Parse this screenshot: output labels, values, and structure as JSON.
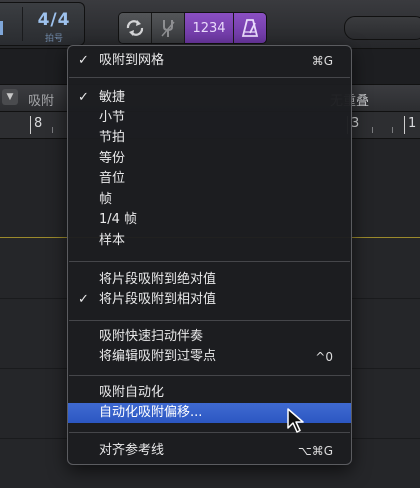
{
  "toolbar": {
    "time_signature": "4/4",
    "time_signature_label": "拍号",
    "count_in_label": "1234",
    "snap_label": "吸附",
    "overlap_label": "无重叠"
  },
  "ruler": {
    "bars": [
      "8",
      "3",
      "1"
    ]
  },
  "menu": {
    "snap_to_grid": {
      "label": "吸附到网格",
      "checked": true,
      "shortcut": "⌘G"
    },
    "snap_modes": [
      {
        "label": "敏捷",
        "checked": true
      },
      {
        "label": "小节",
        "checked": false
      },
      {
        "label": "节拍",
        "checked": false
      },
      {
        "label": "等份",
        "checked": false
      },
      {
        "label": "音位",
        "checked": false
      },
      {
        "label": "帧",
        "checked": false
      },
      {
        "label": "1/4 帧",
        "checked": false
      },
      {
        "label": "样本",
        "checked": false
      }
    ],
    "snap_regions": [
      {
        "label": "将片段吸附到绝对值",
        "checked": false
      },
      {
        "label": "将片段吸附到相对值",
        "checked": true
      }
    ],
    "snap_misc": [
      {
        "label": "吸附快速扫动伴奏",
        "shortcut": ""
      },
      {
        "label": "将编辑吸附到过零点",
        "shortcut": "^0"
      }
    ],
    "automation": [
      {
        "label": "吸附自动化",
        "highlighted": false
      },
      {
        "label": "自动化吸附偏移...",
        "highlighted": true
      }
    ],
    "alignment_guides": {
      "label": "对齐参考线",
      "shortcut": "⌥⌘G"
    },
    "check_mark": "✓"
  },
  "colors": {
    "menu_background": "#1c1d20",
    "highlight": "#3460c8",
    "count_in_active": "#7a42b2",
    "lcd_text": "#9ec2ee"
  },
  "icons": [
    "cycle-icon",
    "tuner-icon",
    "metronome-icon",
    "mouse-pointer-icon"
  ]
}
